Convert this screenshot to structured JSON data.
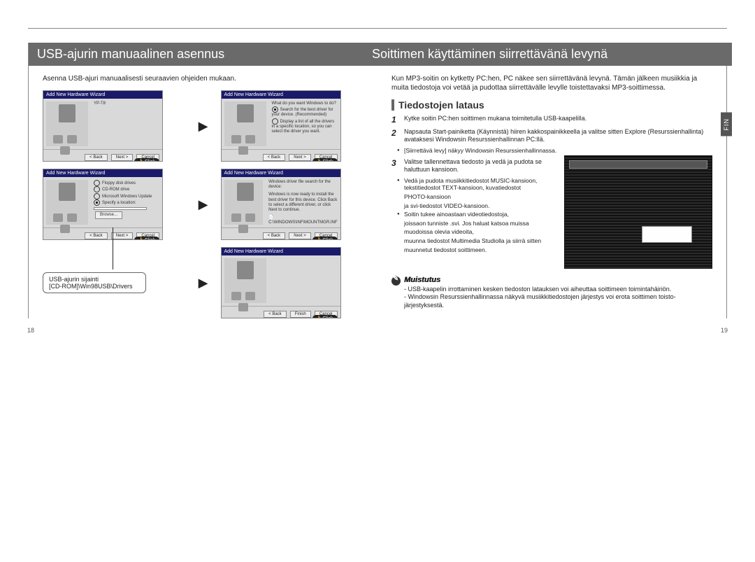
{
  "left": {
    "title": "USB-ajurin manuaalinen asennus",
    "intro": "Asenna USB-ajuri manuaalisesti seuraavien ohjeiden mukaan.",
    "click_label": "Click",
    "wizard_hdr_add": "Add New Hardware Wizard",
    "wizard_hdr_new": "Add New Hardware Wizard",
    "wiz1_text": "YP-T8",
    "wiz2_q": "What do you want Windows to do?",
    "wiz2_opt1": "Search for the best driver for your device. (Recommended)",
    "wiz2_opt2": "Display a list of all the drivers in a specific location, so you can select the driver you want.",
    "wiz3_opt1": "Floppy disk drives",
    "wiz3_opt2": "CD-ROM drive",
    "wiz3_opt3": "Microsoft Windows Update",
    "wiz3_opt4": "Specify a location:",
    "wiz4_text1": "Windows driver file search for the device:",
    "wiz4_text2": "Windows is now ready to install the best driver for this device. Click Back to select a different driver, or click Next to continue.",
    "wiz4_path": "C:\\WINDOWS\\INF\\MOUNTMGR.INF",
    "btn_back": "< Back",
    "btn_next": "Next >",
    "btn_cancel": "Cancel",
    "btn_finish": "Finish",
    "btn_browse": "Browse...",
    "callout_l1": "USB-ajurin sijainti",
    "callout_l2": "[CD-ROM]\\Win98USB\\Drivers",
    "page_num": "18"
  },
  "right": {
    "title": "Soittimen käyttäminen siirrettävänä levynä",
    "fin": "FIN",
    "intro": "Kun MP3-soitin on kytketty PC:hen, PC näkee sen siirrettävänä levynä. Tämän jälkeen musiikkia ja muita tiedostoja voi vetää ja pudottaa siirrettävälle levylle toistettavaksi MP3-soittimessa.",
    "section": "Tiedostojen lataus",
    "s1": "Kytke soitin PC:hen soittimen mukana toimitetulla USB-kaapelilla.",
    "s2": "Napsauta Start-painiketta (Käynnistä) hiiren kakkospainikkeella ja valitse sitten Explore (Resurssienhallinta) avataksesi Windowsin Resurssienhallinnan PC:llä.",
    "s2b": "[Siirrettävä levy] näkyy Windowsin Resurssienhallinnassa.",
    "s3": "Valitse tallennettava tiedosto ja vedä ja pudota se haluttuun kansioon.",
    "s3b1": "Vedä ja pudota musiikkitiedostot MUSIC-kansioon, tekstitiedostot TEXT-kansioon, kuvatiedostot",
    "s3b1b": "PHOTO-kansioon",
    "s3b1c": "ja svi-tiedostot VIDEO-kansioon.",
    "s3b2": "Soitin tukee ainoastaan videotiedostoja,",
    "s3b2b": "joissaon tunniste .svi. Jos haluat katsoa muissa",
    "s3b2c": "muodoissa olevia videoita,",
    "s3b2d": "muunna tiedostot Multimedia Studiolla ja siirrä sitten",
    "s3b2e": "muunnetut tiedostot soittimeen.",
    "note_head": "Muistutus",
    "note1": "- USB-kaapelin irrottaminen kesken tiedoston latauksen voi aiheuttaa soittimeen toimintahäiriön.",
    "note2": "- Windowsin Resurssienhallinnassa näkyvä musiikkitiedostojen järjestys voi erota soittimen toisto-järjestyksestä.",
    "page_num": "19"
  }
}
